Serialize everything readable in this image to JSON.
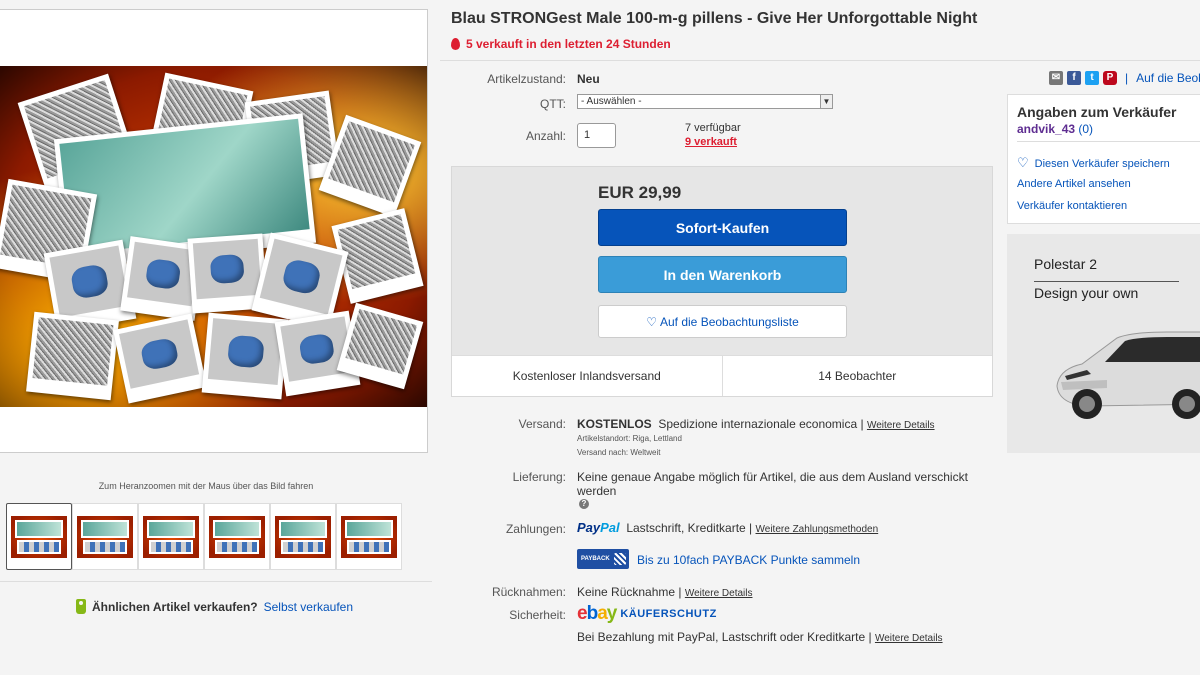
{
  "listing": {
    "title": "Blau STRONGest Male 100-m-g pillens - Give Her Unforgottable Night",
    "sold_recent": "5 verkauft in den letzten 24 Stunden"
  },
  "details": {
    "condition_label": "Artikelzustand:",
    "condition_value": "Neu",
    "qtt_label": "QTT:",
    "qtt_selected": "- Auswählen -",
    "quantity_label": "Anzahl:",
    "quantity_value": "1",
    "available": "7 verfügbar",
    "sold_count": "9 verkauft"
  },
  "buy": {
    "price": "EUR 29,99",
    "buy_now": "Sofort-Kaufen",
    "add_to_cart": "In den Warenkorb",
    "watch": "Auf die Beobachtungsliste",
    "shipping_free": "Kostenloser Inlandsversand",
    "watchers": "14 Beobachter"
  },
  "shipping": {
    "label": "Versand:",
    "cost": "KOSTENLOS",
    "method": "Spedizione internazionale economica |",
    "more": "Weitere Details",
    "location": "Artikelstandort: Riga, Lettland",
    "ships_to": "Versand nach: Weltweit"
  },
  "delivery": {
    "label": "Lieferung:",
    "text": "Keine genaue Angabe möglich für Artikel, die aus dem Ausland verschickt werden"
  },
  "payment": {
    "label": "Zahlungen:",
    "paypal_a": "Pay",
    "paypal_b": "Pal",
    "methods": "Lastschrift,   Kreditkarte  |",
    "more": "Weitere Zahlungsmethoden",
    "payback_badge": "PAYBACK",
    "payback_text": "Bis zu 10fach PAYBACK Punkte sammeln"
  },
  "returns": {
    "label": "Rücknahmen:",
    "text": "Keine Rücknahme |",
    "more": "Weitere Details"
  },
  "security": {
    "label": "Sicherheit:",
    "logo": [
      "e",
      "b",
      "a",
      "y"
    ],
    "badge": "KÄUFERSCHUTZ",
    "text": "Bei Bezahlung mit PayPal, Lastschrift oder Kreditkarte |",
    "more": "Weitere Details"
  },
  "gallery": {
    "zoom_hint": "Zum Heranzoomen mit der Maus über das Bild fahren",
    "sell_question": "Ähnlichen Artikel verkaufen?",
    "sell_link": "Selbst verkaufen"
  },
  "share": {
    "watch_link": "Auf die Beob"
  },
  "seller": {
    "heading": "Angaben zum Verkäufer",
    "name": "andvik_43",
    "score": "(0)",
    "save": "Diesen Verkäufer speichern",
    "other_items": "Andere Artikel ansehen",
    "contact": "Verkäufer kontaktieren"
  },
  "ad": {
    "title": "Polestar 2",
    "subtitle": "Design your own"
  },
  "colors": {
    "link": "#0654ba",
    "alert": "#dd1e31",
    "buy_button": "#0654ba",
    "cart_button": "#3a9cd8"
  }
}
